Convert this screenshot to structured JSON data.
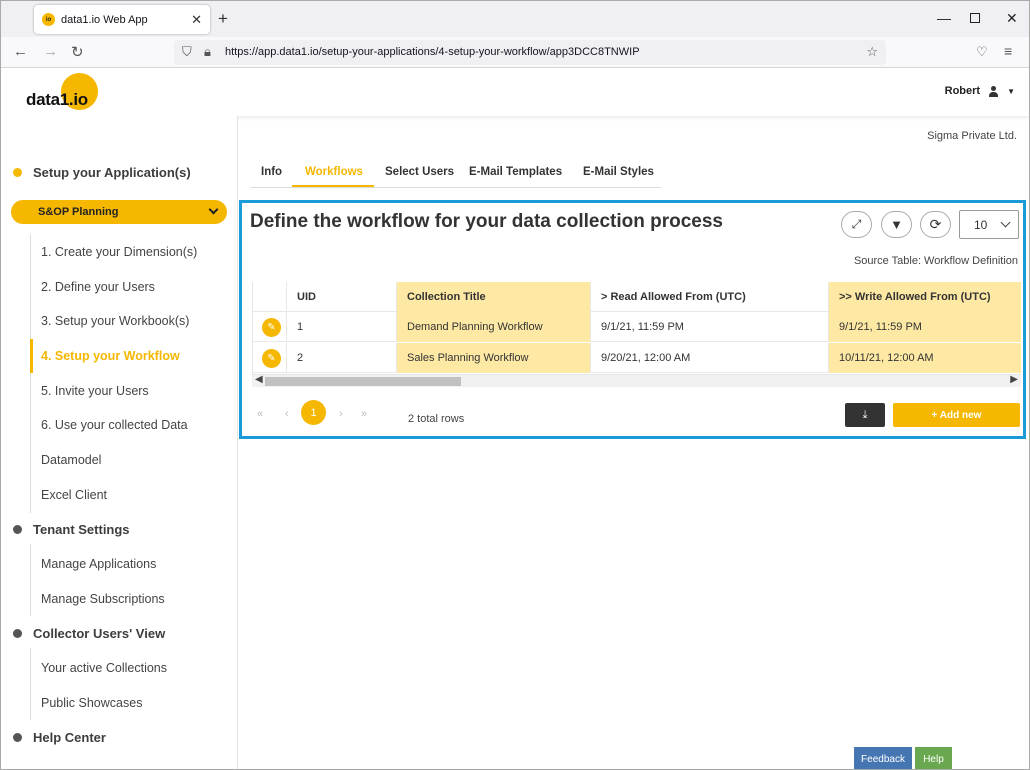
{
  "browser": {
    "tab_title": "data1.io Web App",
    "favicon_text": "io",
    "url": "https://app.data1.io/setup-your-applications/4-setup-your-workflow/app3DCC8TNWIP"
  },
  "header": {
    "logo": "data1.io",
    "user_name": "Robert"
  },
  "sidebar": {
    "setup_section": "Setup your Application(s)",
    "app_selector": "S&OP Planning",
    "setup_items": [
      "1. Create your Dimension(s)",
      "2. Define your Users",
      "3. Setup your Workbook(s)",
      "4. Setup your Workflow",
      "5. Invite your Users",
      "6. Use your collected Data",
      "Datamodel",
      "Excel Client"
    ],
    "tenant_section": "Tenant Settings",
    "tenant_items": [
      "Manage Applications",
      "Manage Subscriptions"
    ],
    "collector_section": "Collector Users' View",
    "collector_items": [
      "Your active Collections",
      "Public Showcases"
    ],
    "help_section": "Help Center"
  },
  "main": {
    "company": "Sigma Private Ltd.",
    "tabs": [
      "Info",
      "Workflows",
      "Select Users",
      "E-Mail Templates",
      "E-Mail Styles"
    ],
    "active_tab": "Workflows",
    "panel_title": "Define the workflow for your data collection process",
    "page_size": "10",
    "source_table": "Source Table: Workflow Definition",
    "table": {
      "headers": [
        "UID",
        "Collection Title",
        "> Read Allowed From (UTC)",
        ">> Write Allowed From (UTC)"
      ],
      "rows": [
        [
          "1",
          "Demand Planning Workflow",
          "9/1/21, 11:59 PM",
          "9/1/21, 11:59 PM"
        ],
        [
          "2",
          "Sales Planning Workflow",
          "9/20/21, 12:00 AM",
          "10/11/21, 12:00 AM"
        ]
      ]
    },
    "pager": {
      "first": "«",
      "prev": "‹",
      "current": "1",
      "next": "›",
      "last": "»",
      "total": "2 total rows"
    },
    "add_new_label": "+ Add new"
  },
  "footer": {
    "feedback": "Feedback",
    "help": "Help"
  },
  "colors": {
    "accent": "#f5b700",
    "highlight_column": "#fde8a4",
    "panel_border": "#1a9ad6",
    "feedback": "#4676b2",
    "help": "#6aa84f"
  }
}
